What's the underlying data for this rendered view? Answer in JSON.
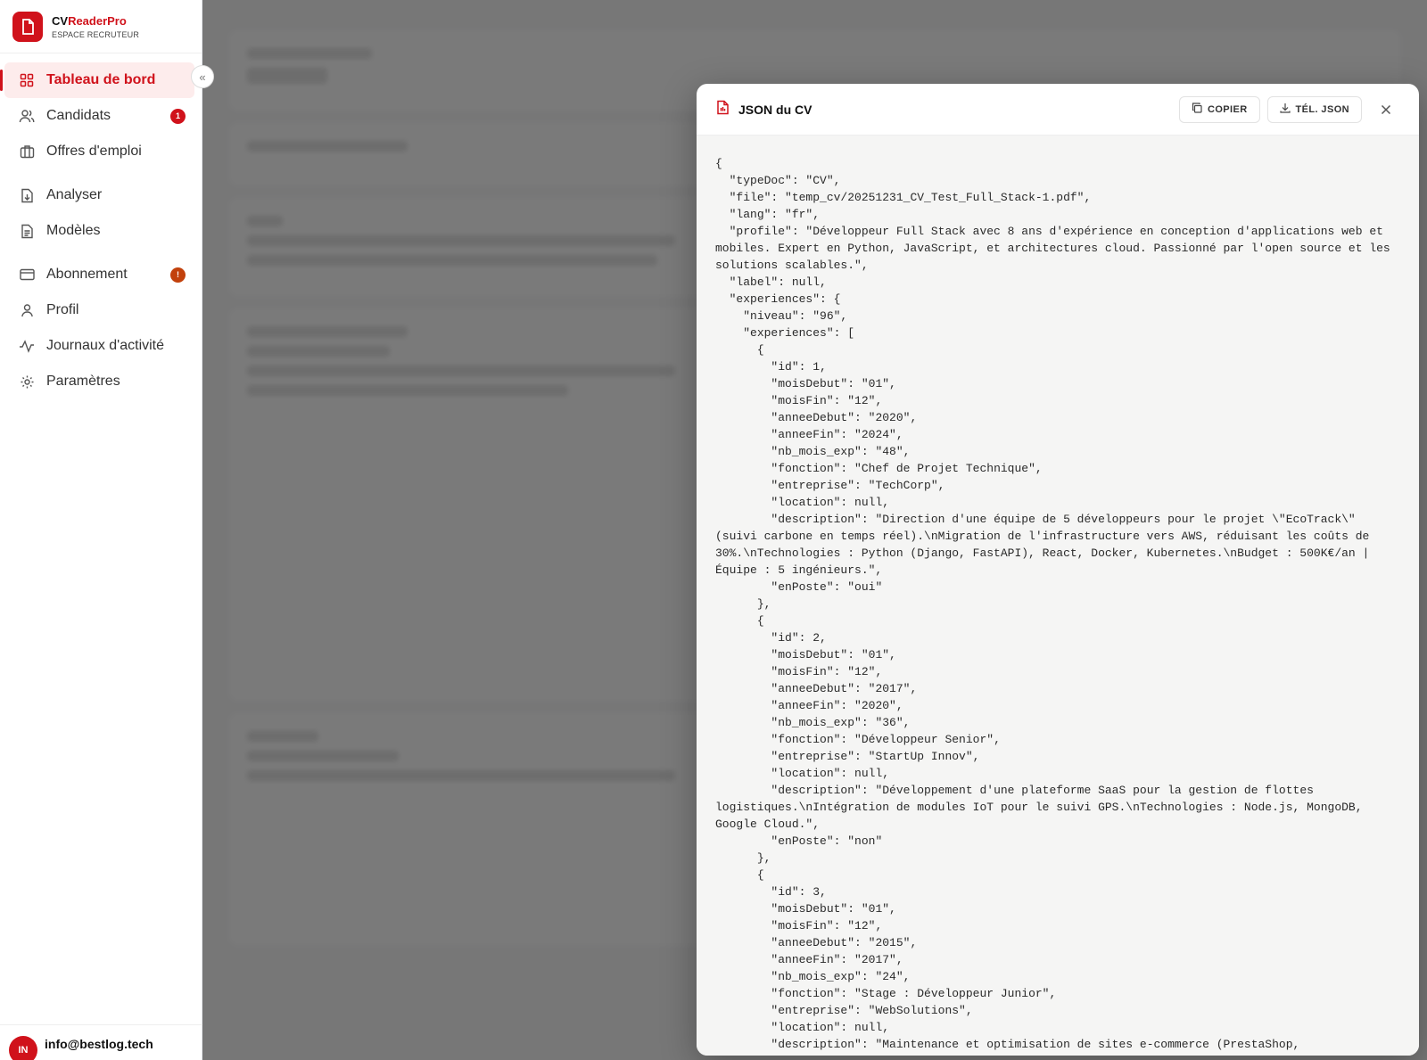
{
  "brand": {
    "prefix": "CV",
    "name": "ReaderPro",
    "subtitle": "ESPACE RECRUTEUR"
  },
  "sidebar": {
    "items": [
      {
        "label": "Tableau de bord",
        "icon": "grid-icon",
        "active": true
      },
      {
        "label": "Candidats",
        "icon": "users-icon",
        "badge": "1"
      },
      {
        "label": "Offres d'emploi",
        "icon": "briefcase-icon"
      },
      {
        "label": "Analyser",
        "icon": "file-upload-icon"
      },
      {
        "label": "Modèles",
        "icon": "document-icon"
      },
      {
        "label": "Abonnement",
        "icon": "credit-card-icon",
        "badge": "!"
      },
      {
        "label": "Profil",
        "icon": "user-icon"
      },
      {
        "label": "Journaux d'activité",
        "icon": "activity-icon"
      },
      {
        "label": "Paramètres",
        "icon": "gear-icon"
      }
    ],
    "collapse_glyph": "«"
  },
  "user": {
    "initials": "IN",
    "email": "info@bestlog.tech"
  },
  "modal": {
    "title": "JSON du CV",
    "copy_label": "COPIER",
    "download_label": "TÉL. JSON",
    "json_text": "{\n  \"typeDoc\": \"CV\",\n  \"file\": \"temp_cv/20251231_CV_Test_Full_Stack-1.pdf\",\n  \"lang\": \"fr\",\n  \"profile\": \"Développeur Full Stack avec 8 ans d'expérience en conception d'applications web et mobiles. Expert en Python, JavaScript, et architectures cloud. Passionné par l'open source et les solutions scalables.\",\n  \"label\": null,\n  \"experiences\": {\n    \"niveau\": \"96\",\n    \"experiences\": [\n      {\n        \"id\": 1,\n        \"moisDebut\": \"01\",\n        \"moisFin\": \"12\",\n        \"anneeDebut\": \"2020\",\n        \"anneeFin\": \"2024\",\n        \"nb_mois_exp\": \"48\",\n        \"fonction\": \"Chef de Projet Technique\",\n        \"entreprise\": \"TechCorp\",\n        \"location\": null,\n        \"description\": \"Direction d'une équipe de 5 développeurs pour le projet \\\"EcoTrack\\\" (suivi carbone en temps réel).\\nMigration de l'infrastructure vers AWS, réduisant les coûts de 30%.\\nTechnologies : Python (Django, FastAPI), React, Docker, Kubernetes.\\nBudget : 500K€/an | Équipe : 5 ingénieurs.\",\n        \"enPoste\": \"oui\"\n      },\n      {\n        \"id\": 2,\n        \"moisDebut\": \"01\",\n        \"moisFin\": \"12\",\n        \"anneeDebut\": \"2017\",\n        \"anneeFin\": \"2020\",\n        \"nb_mois_exp\": \"36\",\n        \"fonction\": \"Développeur Senior\",\n        \"entreprise\": \"StartUp Innov\",\n        \"location\": null,\n        \"description\": \"Développement d'une plateforme SaaS pour la gestion de flottes logistiques.\\nIntégration de modules IoT pour le suivi GPS.\\nTechnologies : Node.js, MongoDB, Google Cloud.\",\n        \"enPoste\": \"non\"\n      },\n      {\n        \"id\": 3,\n        \"moisDebut\": \"01\",\n        \"moisFin\": \"12\",\n        \"anneeDebut\": \"2015\",\n        \"anneeFin\": \"2017\",\n        \"nb_mois_exp\": \"24\",\n        \"fonction\": \"Stage : Développeur Junior\",\n        \"entreprise\": \"WebSolutions\",\n        \"location\": null,\n        \"description\": \"Maintenance et optimisation de sites e-commerce (PrestaShop,"
  },
  "colors": {
    "accent": "#d0121b",
    "badge_orange": "#c2410c",
    "overlay": "#464646"
  }
}
